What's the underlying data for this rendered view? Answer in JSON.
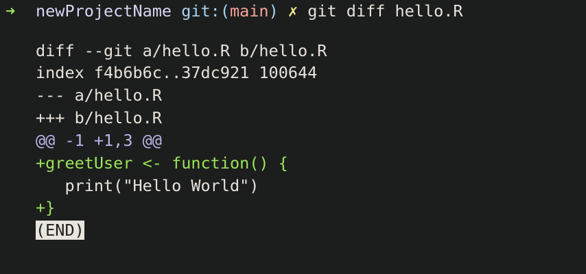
{
  "prompt": {
    "arrow": "➜",
    "directory": "newProjectName",
    "git_label": "git:(",
    "branch": "main",
    "git_close": ")",
    "dirty_mark": "✗",
    "command": "git diff hello.R"
  },
  "diff": {
    "header": "diff --git a/hello.R b/hello.R",
    "index": "index f4b6b6c..37dc921 100644",
    "old_file": "--- a/hello.R",
    "new_file": "+++ b/hello.R",
    "hunk": "@@ -1 +1,3 @@",
    "lines": [
      {
        "type": "add",
        "text": "+greetUser <- function() {"
      },
      {
        "type": "context",
        "text": "   print(\"Hello World\")"
      },
      {
        "type": "add",
        "text": "+}"
      }
    ]
  },
  "pager_status": "(END)",
  "colors": {
    "background": "#1c1e1d",
    "added": "#9be35a",
    "hunk": "#b9b5ea",
    "branch": "#f4a39b"
  }
}
